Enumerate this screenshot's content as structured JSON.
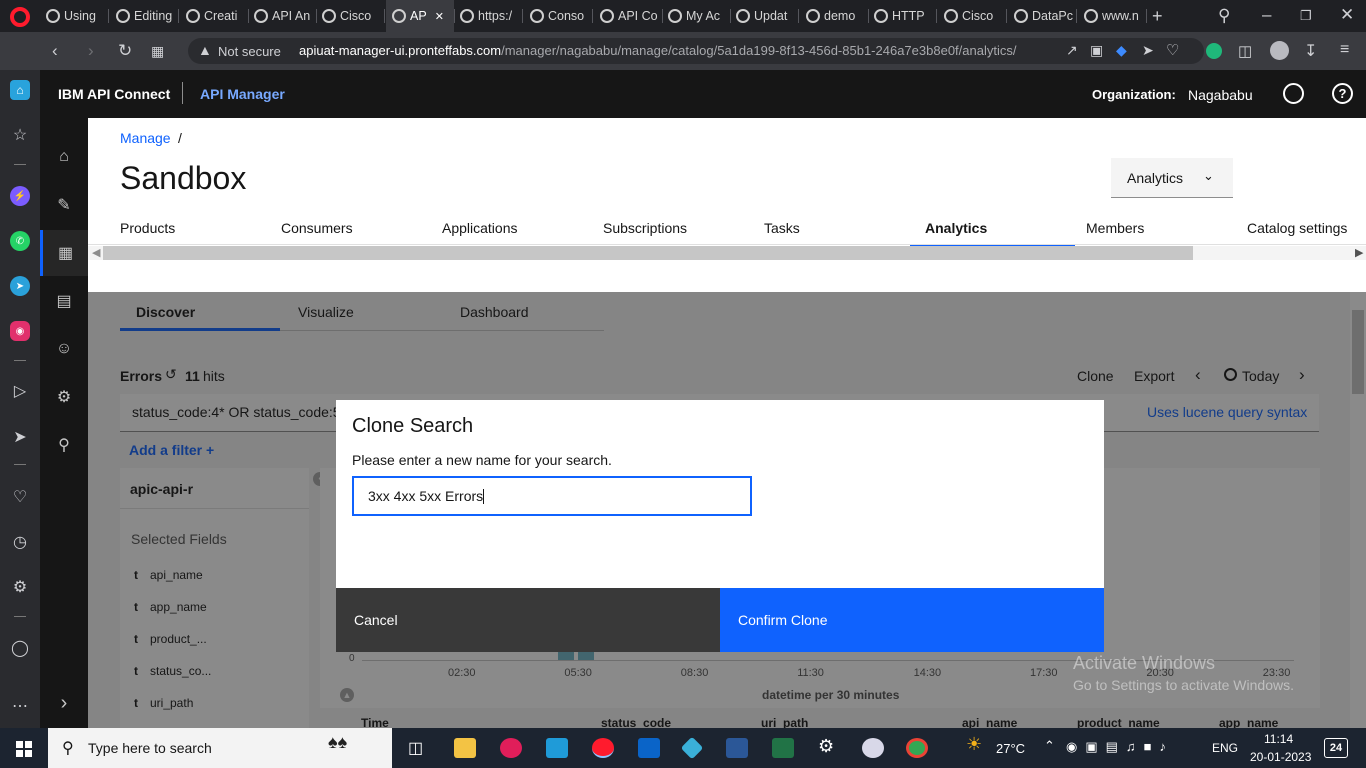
{
  "browser": {
    "tabs": [
      "Using",
      "Editing",
      "Creati",
      "API An",
      "Cisco",
      "AP",
      "https:/",
      "Conso",
      "API Co",
      "My Ac",
      "Updat",
      "demo",
      "HTTP",
      "Cisco",
      "DataPc",
      "www.n"
    ],
    "url_security": "Not secure",
    "url_host": "apiuat-manager-ui.pronteffabs.com",
    "url_path": "/manager/nagababu/manage/catalog/5a1da199-8f13-456d-85b1-246a7e3b8e0f/analytics/",
    "colors": {
      "tabbar": "#1f2024",
      "toolbar": "#3a3b40"
    }
  },
  "header": {
    "product": "IBM API Connect",
    "app": "API Manager",
    "org_label": "Organization:",
    "org_value": "Nagababu"
  },
  "page": {
    "breadcrumb": "Manage",
    "breadcrumb_sep": "/",
    "title": "Sandbox",
    "dropdown": "Analytics",
    "tabs": [
      "Products",
      "Consumers",
      "Applications",
      "Subscriptions",
      "Tasks",
      "Analytics",
      "Members",
      "Catalog settings"
    ],
    "active_tab": "Analytics"
  },
  "analytics": {
    "subtabs": [
      "Discover",
      "Visualize",
      "Dashboard"
    ],
    "search_name": "Errors",
    "hits_count": "11",
    "hits_label": "hits",
    "actions": {
      "clone": "Clone",
      "export": "Export",
      "range": "Today"
    },
    "query": "status_code:4* OR status_code:5",
    "query_hint": "Uses lucene query syntax",
    "add_filter": "Add a filter",
    "index_pattern": "apic-api-r",
    "selected_fields_label": "Selected Fields",
    "fields": [
      "api_name",
      "app_name",
      "product_...",
      "status_co...",
      "uri_path"
    ],
    "field_type": "t",
    "chart_axis": {
      "y0": "0",
      "ticks": [
        "02:30",
        "05:30",
        "08:30",
        "11:30",
        "14:30",
        "17:30",
        "20:30",
        "23:30"
      ],
      "xlabel": "datetime per 30 minutes"
    },
    "table_headers": [
      "Time",
      "status_code",
      "uri_path",
      "api_name",
      "product_name",
      "app_name"
    ]
  },
  "modal": {
    "title": "Clone Search",
    "label": "Please enter a new name for your search.",
    "input_value": "3xx 4xx 5xx Errors",
    "cancel": "Cancel",
    "confirm": "Confirm Clone",
    "colors": {
      "primary": "#0f62fe",
      "secondary": "#393939"
    }
  },
  "watermark": {
    "line1": "Activate Windows",
    "line2": "Go to Settings to activate Windows."
  },
  "taskbar": {
    "search_placeholder": "Type here to search",
    "weather": "27°C",
    "lang": "ENG",
    "time": "11:14",
    "date": "20-01-2023",
    "notif_count": "24"
  }
}
